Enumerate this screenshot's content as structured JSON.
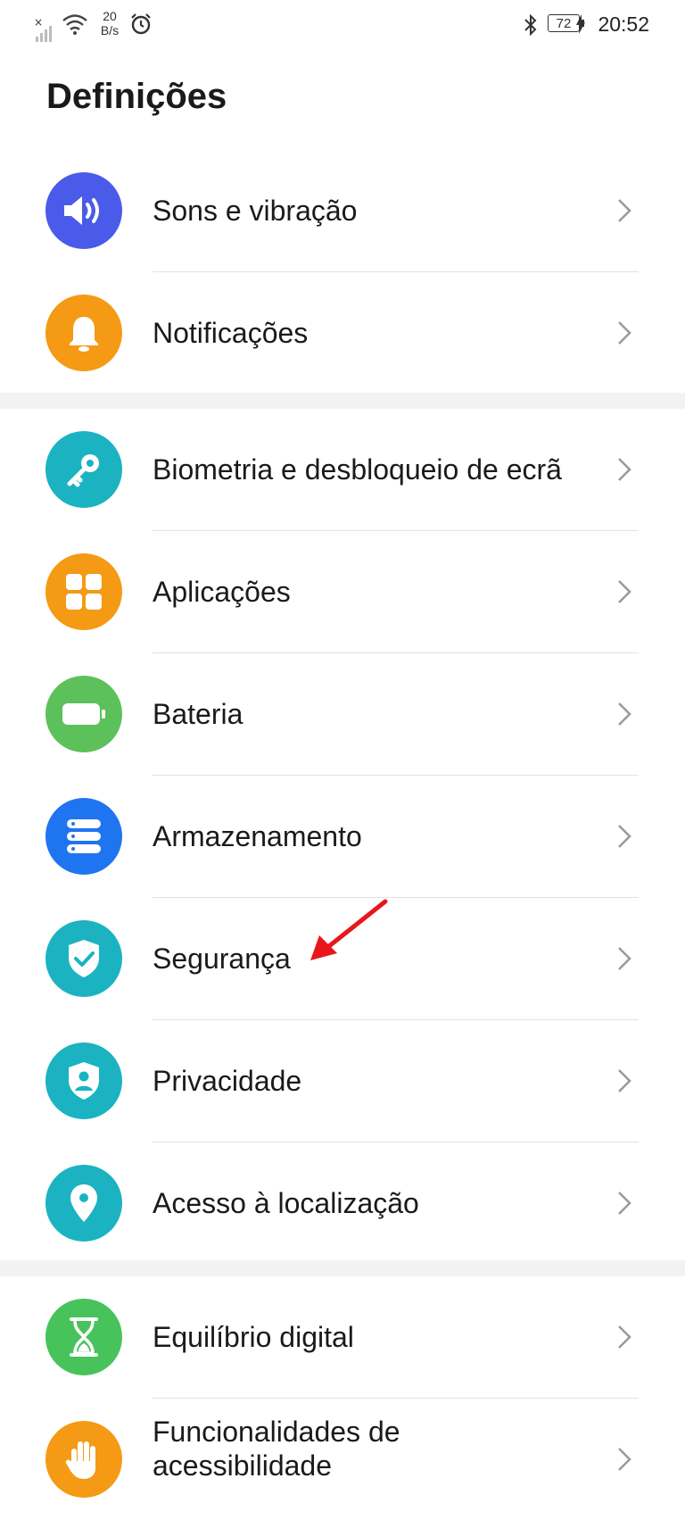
{
  "status_bar": {
    "net_speed_value": "20",
    "net_speed_unit": "B/s",
    "battery_level": "72",
    "time": "20:52",
    "icons": [
      "no-signal-icon",
      "wifi-icon",
      "alarm-icon",
      "bluetooth-icon",
      "battery-icon",
      "charging-icon"
    ]
  },
  "page": {
    "title": "Definições"
  },
  "settings": {
    "items": [
      {
        "label": "Sons e vibração",
        "icon": "speaker-icon",
        "color": "#4a5bea"
      },
      {
        "label": "Notificações",
        "icon": "bell-icon",
        "color": "#f59a14"
      },
      {
        "label": "Biometria e desbloqueio de ecrã",
        "icon": "key-icon",
        "color": "#1bb3c2"
      },
      {
        "label": "Aplicações",
        "icon": "apps-grid-icon",
        "color": "#f59a14"
      },
      {
        "label": "Bateria",
        "icon": "battery-icon",
        "color": "#5cc15a"
      },
      {
        "label": "Armazenamento",
        "icon": "storage-icon",
        "color": "#1f74f0"
      },
      {
        "label": "Segurança",
        "icon": "shield-check-icon",
        "color": "#1bb3c2"
      },
      {
        "label": "Privacidade",
        "icon": "privacy-shield-icon",
        "color": "#1bb3c2"
      },
      {
        "label": "Acesso à localização",
        "icon": "location-pin-icon",
        "color": "#1bb3c2"
      },
      {
        "label": "Equilíbrio digital",
        "icon": "hourglass-icon",
        "color": "#48c35c"
      },
      {
        "label": "Funcionalidades de acessibilidade",
        "label_line1": "Funcionalidades de",
        "label_line2": "acessibilidade",
        "icon": "hand-icon",
        "color": "#f59a14"
      }
    ]
  },
  "colors": {
    "background": "#ffffff",
    "section_gap": "#f2f2f2",
    "annotation_arrow": "#e8161b"
  }
}
